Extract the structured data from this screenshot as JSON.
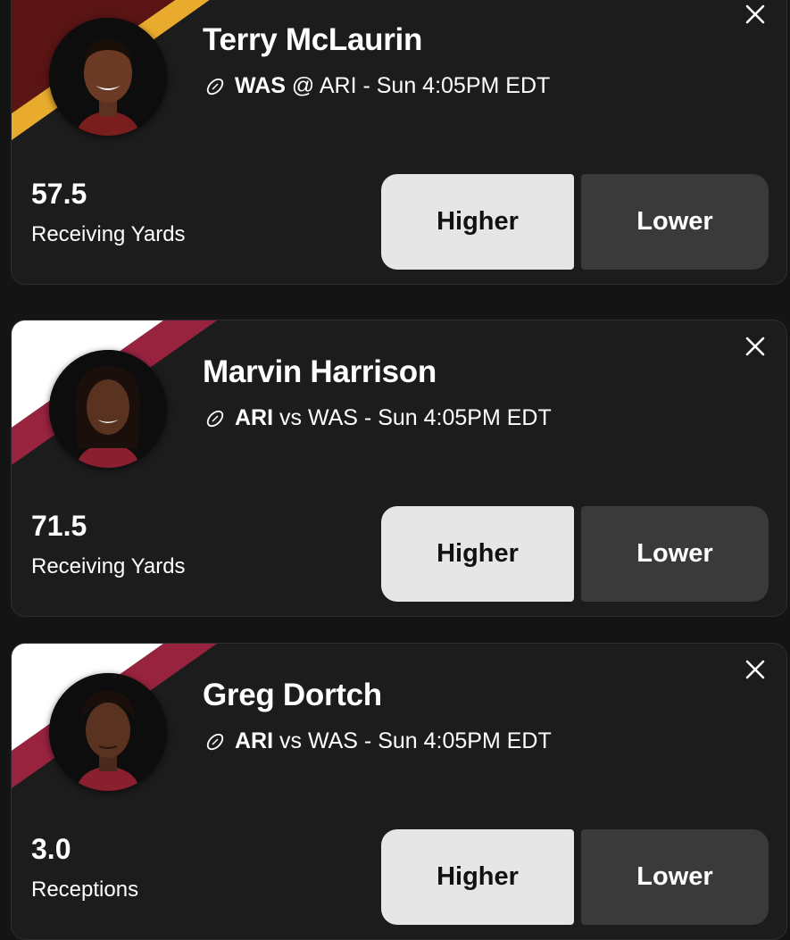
{
  "cards": [
    {
      "player_name": "Terry McLaurin",
      "team": "WAS",
      "matchup_rest": " @ ARI - Sun 4:05PM EDT",
      "stat_value": "57.5",
      "stat_label": "Receiving Yards",
      "higher_label": "Higher",
      "lower_label": "Lower",
      "team_colors": [
        "#5a1414",
        "#ffb612"
      ]
    },
    {
      "player_name": "Marvin Harrison",
      "team": "ARI",
      "matchup_rest": " vs WAS - Sun 4:05PM EDT",
      "stat_value": "71.5",
      "stat_label": "Receiving Yards",
      "higher_label": "Higher",
      "lower_label": "Lower",
      "team_colors": [
        "#ffffff",
        "#97233f"
      ]
    },
    {
      "player_name": "Greg Dortch",
      "team": "ARI",
      "matchup_rest": " vs WAS - Sun 4:05PM EDT",
      "stat_value": "3.0",
      "stat_label": "Receptions",
      "higher_label": "Higher",
      "lower_label": "Lower",
      "team_colors": [
        "#ffffff",
        "#97233f"
      ]
    }
  ],
  "icons": {
    "sport": "football-icon",
    "close": "close-icon"
  },
  "colors": {
    "background": "#141414",
    "card": "#1c1c1c",
    "higher_button": "#e6e6e6",
    "lower_button": "#3a3a3a"
  }
}
